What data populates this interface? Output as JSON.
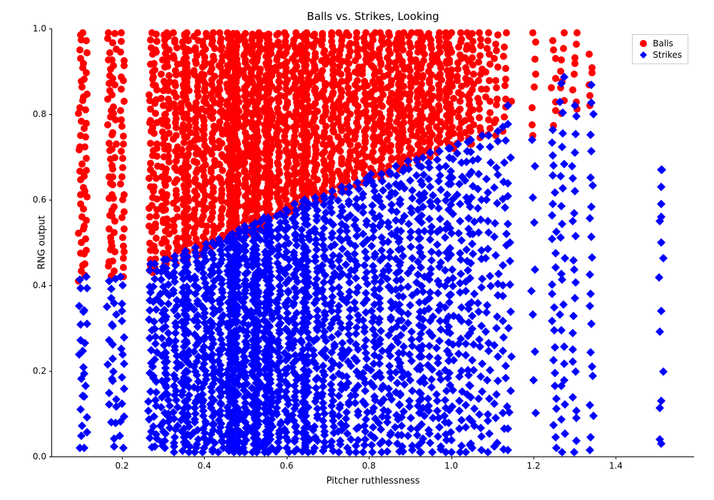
{
  "chart_data": {
    "type": "scatter",
    "title": "Balls vs. Strikes, Looking",
    "xlabel": "Pitcher ruthlessness",
    "ylabel": "RNG output",
    "xlim": [
      0.03,
      1.59
    ],
    "ylim": [
      0.0,
      1.0
    ],
    "xticks": [
      0.2,
      0.4,
      0.6,
      0.8,
      1.0,
      1.2,
      1.4
    ],
    "yticks": [
      0.0,
      0.2,
      0.4,
      0.6,
      0.8,
      1.0
    ],
    "legend_position": "upper right",
    "series": [
      {
        "name": "Balls",
        "color": "#ff0000",
        "marker": "circle",
        "columns": [
          0.1,
          0.11,
          0.17,
          0.18,
          0.2,
          0.27,
          0.28,
          0.3,
          0.31,
          0.33,
          0.35,
          0.36,
          0.38,
          0.4,
          0.42,
          0.44,
          0.46,
          0.47,
          0.48,
          0.5,
          0.52,
          0.53,
          0.55,
          0.56,
          0.58,
          0.6,
          0.62,
          0.64,
          0.65,
          0.67,
          0.69,
          0.71,
          0.73,
          0.75,
          0.77,
          0.79,
          0.81,
          0.83,
          0.85,
          0.87,
          0.88,
          0.9,
          0.92,
          0.93,
          0.95,
          0.97,
          0.99,
          1.0,
          1.02,
          1.04,
          1.05,
          1.07,
          1.09,
          1.11,
          1.13,
          1.14,
          1.2,
          1.25,
          1.27,
          1.3,
          1.34
        ],
        "column_y_ranges": [
          [
            0.41,
            0.99
          ],
          [
            0.42,
            0.99
          ],
          [
            0.42,
            0.99
          ],
          [
            0.42,
            0.99
          ],
          [
            0.42,
            0.99
          ],
          [
            0.43,
            0.99
          ],
          [
            0.43,
            0.99
          ],
          [
            0.45,
            0.99
          ],
          [
            0.45,
            0.99
          ],
          [
            0.45,
            0.99
          ],
          [
            0.46,
            0.99
          ],
          [
            0.46,
            0.99
          ],
          [
            0.47,
            0.99
          ],
          [
            0.48,
            0.99
          ],
          [
            0.49,
            0.99
          ],
          [
            0.5,
            0.99
          ],
          [
            0.5,
            0.99
          ],
          [
            0.51,
            0.99
          ],
          [
            0.51,
            0.99
          ],
          [
            0.52,
            0.99
          ],
          [
            0.52,
            0.99
          ],
          [
            0.53,
            0.99
          ],
          [
            0.54,
            0.99
          ],
          [
            0.55,
            0.99
          ],
          [
            0.56,
            0.99
          ],
          [
            0.57,
            0.99
          ],
          [
            0.57,
            0.99
          ],
          [
            0.58,
            0.99
          ],
          [
            0.59,
            0.99
          ],
          [
            0.6,
            0.99
          ],
          [
            0.6,
            0.99
          ],
          [
            0.61,
            0.99
          ],
          [
            0.62,
            0.99
          ],
          [
            0.62,
            0.99
          ],
          [
            0.63,
            0.99
          ],
          [
            0.64,
            0.99
          ],
          [
            0.65,
            0.99
          ],
          [
            0.65,
            0.99
          ],
          [
            0.66,
            0.99
          ],
          [
            0.67,
            0.99
          ],
          [
            0.67,
            0.99
          ],
          [
            0.68,
            0.99
          ],
          [
            0.69,
            0.99
          ],
          [
            0.7,
            0.99
          ],
          [
            0.7,
            0.99
          ],
          [
            0.71,
            0.99
          ],
          [
            0.72,
            0.99
          ],
          [
            0.72,
            0.99
          ],
          [
            0.73,
            0.99
          ],
          [
            0.73,
            0.99
          ],
          [
            0.73,
            0.99
          ],
          [
            0.74,
            0.99
          ],
          [
            0.75,
            0.99
          ],
          [
            0.75,
            0.99
          ],
          [
            0.76,
            0.99
          ],
          [
            0.83,
            0.83
          ],
          [
            0.75,
            0.99
          ],
          [
            0.77,
            0.98
          ],
          [
            0.8,
            0.99
          ],
          [
            0.81,
            0.99
          ],
          [
            0.82,
            0.94
          ]
        ],
        "points_per_column": [
          28,
          26,
          30,
          28,
          30,
          32,
          34,
          36,
          40,
          44,
          46,
          48,
          50,
          56,
          50,
          48,
          54,
          56,
          58,
          60,
          56,
          54,
          52,
          50,
          48,
          46,
          50,
          48,
          46,
          44,
          42,
          40,
          38,
          36,
          34,
          36,
          38,
          36,
          34,
          32,
          30,
          28,
          26,
          28,
          30,
          28,
          26,
          24,
          22,
          20,
          18,
          16,
          14,
          12,
          10,
          1,
          8,
          8,
          8,
          8,
          6
        ]
      },
      {
        "name": "Strikes",
        "color": "#0000ff",
        "marker": "diamond",
        "columns": [
          0.1,
          0.11,
          0.17,
          0.18,
          0.2,
          0.27,
          0.28,
          0.3,
          0.31,
          0.33,
          0.35,
          0.36,
          0.38,
          0.4,
          0.42,
          0.44,
          0.46,
          0.47,
          0.48,
          0.5,
          0.52,
          0.53,
          0.55,
          0.56,
          0.58,
          0.6,
          0.62,
          0.64,
          0.65,
          0.67,
          0.69,
          0.71,
          0.73,
          0.75,
          0.77,
          0.79,
          0.81,
          0.83,
          0.85,
          0.87,
          0.88,
          0.9,
          0.92,
          0.93,
          0.95,
          0.97,
          0.99,
          1.0,
          1.02,
          1.04,
          1.05,
          1.07,
          1.09,
          1.11,
          1.13,
          1.14,
          1.2,
          1.25,
          1.27,
          1.3,
          1.34,
          1.51
        ],
        "column_y_ranges": [
          [
            0.02,
            0.42
          ],
          [
            0.02,
            0.42
          ],
          [
            0.08,
            0.41
          ],
          [
            0.02,
            0.42
          ],
          [
            0.02,
            0.42
          ],
          [
            0.02,
            0.45
          ],
          [
            0.02,
            0.45
          ],
          [
            0.02,
            0.46
          ],
          [
            0.02,
            0.46
          ],
          [
            0.01,
            0.47
          ],
          [
            0.01,
            0.47
          ],
          [
            0.01,
            0.48
          ],
          [
            0.01,
            0.49
          ],
          [
            0.01,
            0.5
          ],
          [
            0.01,
            0.5
          ],
          [
            0.01,
            0.51
          ],
          [
            0.01,
            0.52
          ],
          [
            0.01,
            0.52
          ],
          [
            0.01,
            0.53
          ],
          [
            0.01,
            0.54
          ],
          [
            0.01,
            0.54
          ],
          [
            0.01,
            0.55
          ],
          [
            0.01,
            0.56
          ],
          [
            0.01,
            0.56
          ],
          [
            0.01,
            0.57
          ],
          [
            0.01,
            0.58
          ],
          [
            0.01,
            0.59
          ],
          [
            0.01,
            0.6
          ],
          [
            0.01,
            0.6
          ],
          [
            0.01,
            0.61
          ],
          [
            0.01,
            0.61
          ],
          [
            0.01,
            0.62
          ],
          [
            0.01,
            0.63
          ],
          [
            0.01,
            0.63
          ],
          [
            0.01,
            0.64
          ],
          [
            0.01,
            0.65
          ],
          [
            0.01,
            0.66
          ],
          [
            0.01,
            0.66
          ],
          [
            0.01,
            0.67
          ],
          [
            0.01,
            0.68
          ],
          [
            0.01,
            0.68
          ],
          [
            0.01,
            0.69
          ],
          [
            0.01,
            0.7
          ],
          [
            0.01,
            0.7
          ],
          [
            0.01,
            0.71
          ],
          [
            0.01,
            0.72
          ],
          [
            0.01,
            0.72
          ],
          [
            0.01,
            0.72
          ],
          [
            0.01,
            0.73
          ],
          [
            0.01,
            0.74
          ],
          [
            0.01,
            0.74
          ],
          [
            0.01,
            0.75
          ],
          [
            0.01,
            0.75
          ],
          [
            0.01,
            0.76
          ],
          [
            0.01,
            0.77
          ],
          [
            0.01,
            0.82
          ],
          [
            0.1,
            0.74
          ],
          [
            0.02,
            0.77
          ],
          [
            0.01,
            0.9
          ],
          [
            0.01,
            0.82
          ],
          [
            0.01,
            0.87
          ],
          [
            0.02,
            0.67
          ]
        ],
        "points_per_column": [
          14,
          12,
          10,
          14,
          16,
          20,
          24,
          28,
          32,
          36,
          40,
          42,
          44,
          48,
          50,
          52,
          54,
          56,
          58,
          60,
          60,
          58,
          56,
          56,
          54,
          52,
          54,
          52,
          50,
          48,
          48,
          46,
          44,
          42,
          40,
          42,
          44,
          42,
          40,
          38,
          36,
          34,
          34,
          36,
          38,
          36,
          34,
          32,
          30,
          30,
          28,
          26,
          24,
          22,
          20,
          16,
          10,
          26,
          26,
          24,
          22,
          8
        ],
        "isolated_points": [
          [
            1.51,
            0.67
          ],
          [
            1.51,
            0.63
          ],
          [
            1.51,
            0.59
          ],
          [
            1.51,
            0.56
          ],
          [
            1.51,
            0.5
          ],
          [
            1.51,
            0.34
          ],
          [
            1.51,
            0.13
          ],
          [
            1.51,
            0.03
          ]
        ]
      }
    ],
    "decision_boundary": "Approximate boundary between Balls (above) and Strikes (below) rises from y≈0.42 at x≈0.10 to y≈0.77 at x≈1.14, i.e. RNG threshold ≈ 0.38 + 0.34·x over observed range."
  },
  "legend": {
    "items": [
      {
        "label": "Balls",
        "color": "#ff0000",
        "marker": "circle"
      },
      {
        "label": "Strikes",
        "color": "#0000ff",
        "marker": "diamond"
      }
    ]
  }
}
